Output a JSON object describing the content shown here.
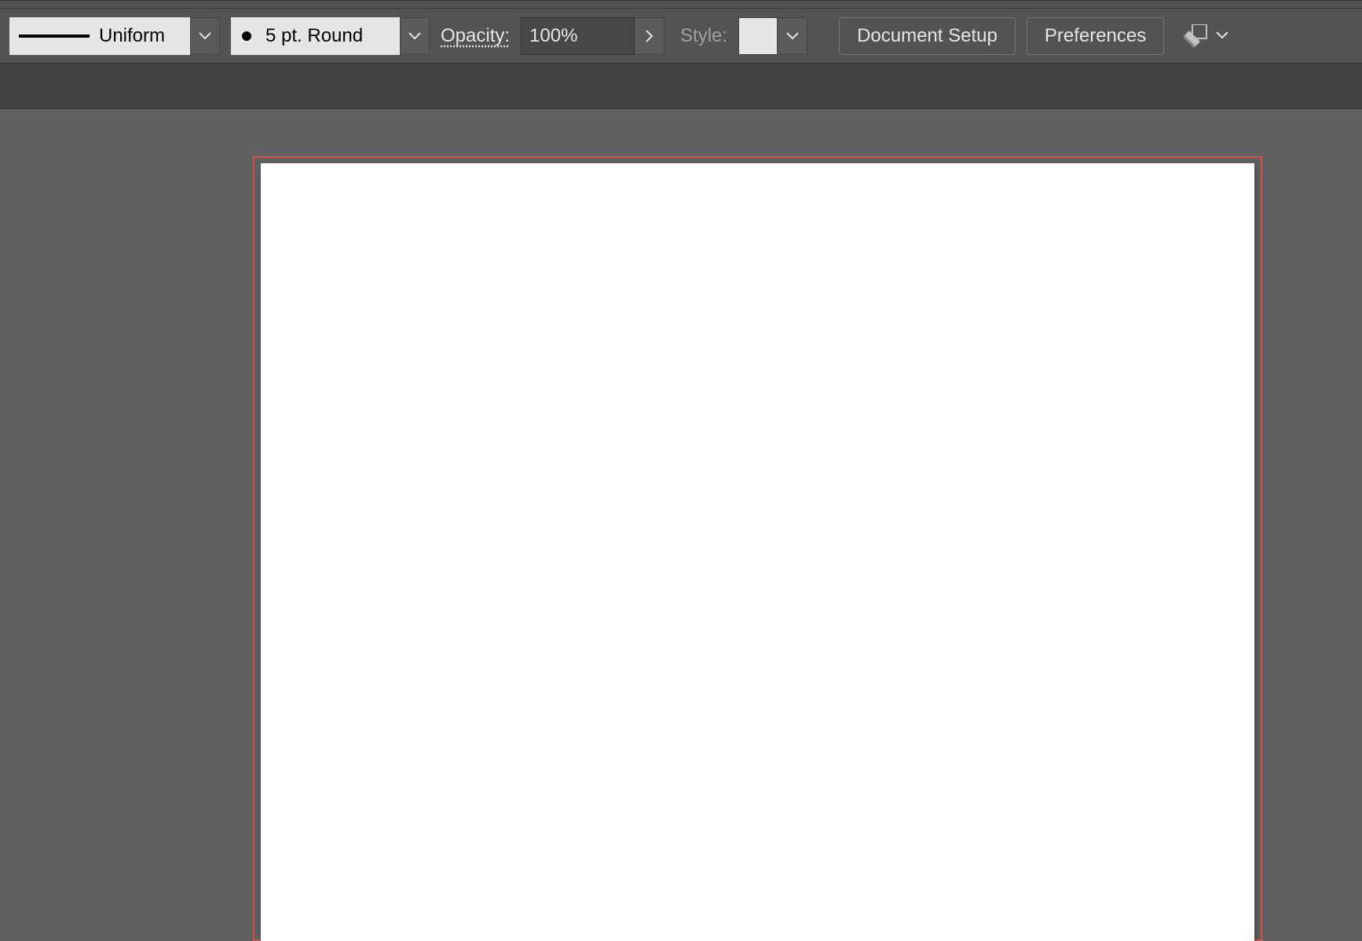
{
  "controlBar": {
    "strokeProfile": {
      "label": "Uniform"
    },
    "brushPreset": {
      "label": "5 pt. Round"
    },
    "opacityLabel": "Opacity:",
    "opacityValue": "100%",
    "styleLabel": "Style:",
    "documentSetupButton": "Document Setup",
    "preferencesButton": "Preferences"
  },
  "colors": {
    "bleedOutline": "#d75050",
    "artboard": "#ffffff",
    "canvasBg": "#606060"
  }
}
